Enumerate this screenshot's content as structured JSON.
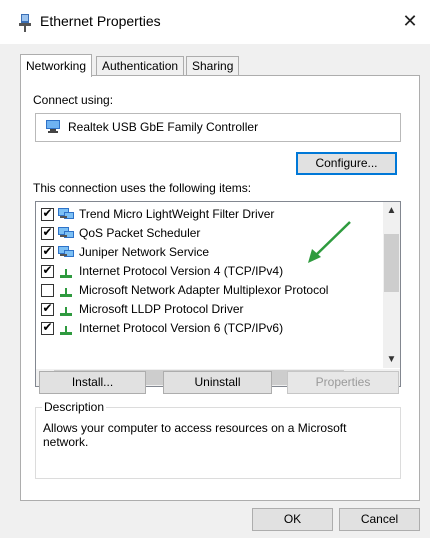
{
  "window": {
    "title": "Ethernet Properties",
    "close_label": "✕"
  },
  "tabs": [
    {
      "label": "Networking",
      "active": true
    },
    {
      "label": "Authentication",
      "active": false
    },
    {
      "label": "Sharing",
      "active": false
    }
  ],
  "connect": {
    "label": "Connect using:",
    "adapter": "Realtek USB GbE Family Controller",
    "configure_label": "Configure..."
  },
  "items": {
    "label": "This connection uses the following items:",
    "rows": [
      {
        "checked": true,
        "icon": "network-client-icon",
        "text": "Trend Micro LightWeight Filter Driver"
      },
      {
        "checked": true,
        "icon": "network-client-icon",
        "text": "QoS Packet Scheduler"
      },
      {
        "checked": true,
        "icon": "network-client-icon",
        "text": "Juniper Network Service"
      },
      {
        "checked": true,
        "icon": "protocol-icon",
        "text": "Internet Protocol Version 4 (TCP/IPv4)"
      },
      {
        "checked": false,
        "icon": "protocol-icon",
        "text": "Microsoft Network Adapter Multiplexor Protocol"
      },
      {
        "checked": true,
        "icon": "protocol-icon",
        "text": "Microsoft LLDP Protocol Driver"
      },
      {
        "checked": true,
        "icon": "protocol-icon",
        "text": "Internet Protocol Version 6 (TCP/IPv6)"
      }
    ]
  },
  "buttons": {
    "install": "Install...",
    "uninstall": "Uninstall",
    "properties": "Properties",
    "ok": "OK",
    "cancel": "Cancel"
  },
  "description": {
    "legend": "Description",
    "text": "Allows your computer to access resources on a Microsoft network."
  },
  "colors": {
    "accent": "#0078d7",
    "annotation_arrow": "#2e9b3e"
  }
}
